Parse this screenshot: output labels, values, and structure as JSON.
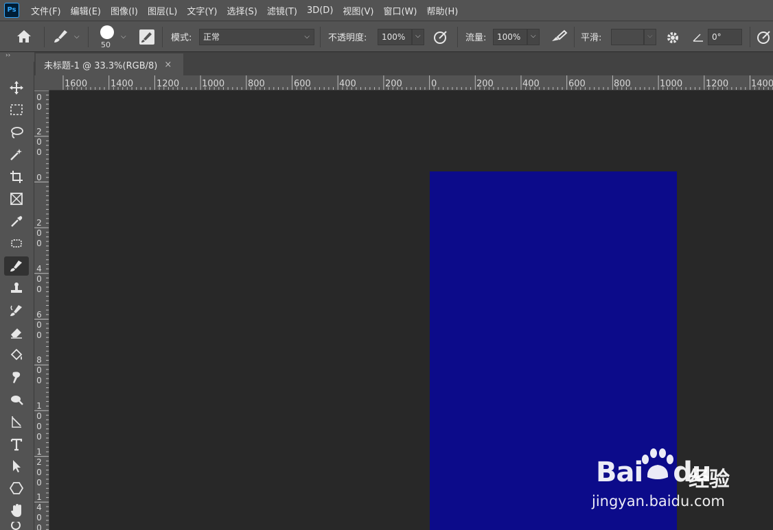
{
  "app": {
    "logo_text": "Ps"
  },
  "menu": [
    {
      "label": "文件(F)"
    },
    {
      "label": "编辑(E)"
    },
    {
      "label": "图像(I)"
    },
    {
      "label": "图层(L)"
    },
    {
      "label": "文字(Y)"
    },
    {
      "label": "选择(S)"
    },
    {
      "label": "滤镜(T)"
    },
    {
      "label": "3D(D)"
    },
    {
      "label": "视图(V)"
    },
    {
      "label": "窗口(W)"
    },
    {
      "label": "帮助(H)"
    }
  ],
  "options": {
    "brush_size": "50",
    "mode_label": "模式:",
    "mode_value": "正常",
    "opacity_label": "不透明度:",
    "opacity_value": "100%",
    "flow_label": "流量:",
    "flow_value": "100%",
    "smooth_label": "平滑:",
    "angle_value": "0°"
  },
  "tools_header": "››",
  "document_tab": {
    "title": "未标题-1 @ 33.3%(RGB/8)",
    "close": "×"
  },
  "ruler_top": [
    "1600",
    "1400",
    "1200",
    "1000",
    "800",
    "600",
    "400",
    "200",
    "0",
    "200",
    "400",
    "600",
    "800",
    "1000",
    "1200",
    "1400"
  ],
  "ruler_left": [
    [
      "0",
      "0"
    ],
    [
      "2",
      "0",
      "0"
    ],
    [
      "0"
    ],
    [
      "2",
      "0",
      "0"
    ],
    [
      "4",
      "0",
      "0"
    ],
    [
      "6",
      "0",
      "0"
    ],
    [
      "8",
      "0",
      "0"
    ],
    [
      "1",
      "0",
      "0",
      "0"
    ],
    [
      "1",
      "2",
      "0",
      "0"
    ],
    [
      "1",
      "4",
      "0",
      "0"
    ]
  ],
  "canvas": {
    "document_color": "#0c0b8a",
    "background_color": "#282828"
  },
  "watermark": {
    "brand": "Bai",
    "brand_suffix": "du",
    "cn": "经验",
    "url": "jingyan.baidu.com"
  }
}
